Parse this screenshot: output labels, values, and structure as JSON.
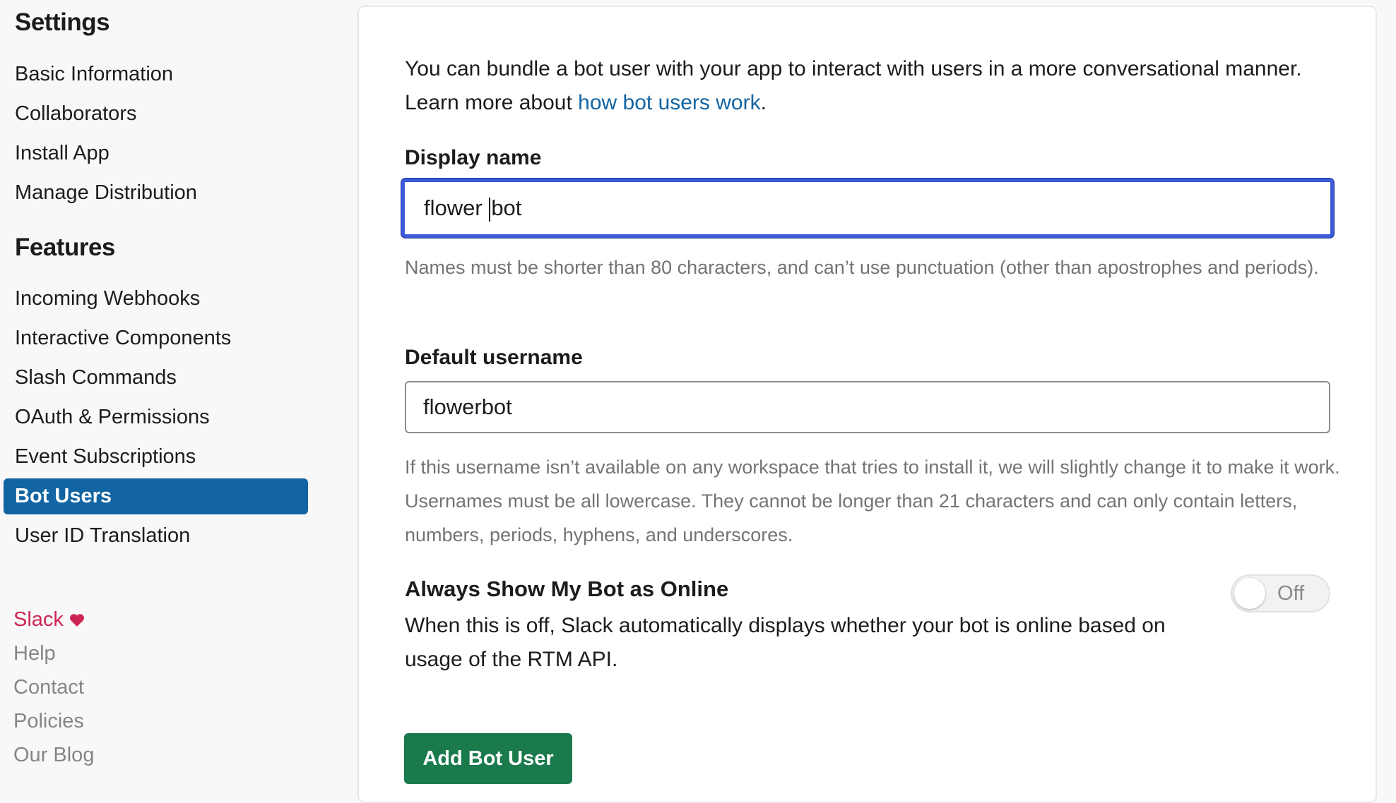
{
  "sidebar": {
    "settings_heading": "Settings",
    "settings_items": [
      {
        "label": "Basic Information"
      },
      {
        "label": "Collaborators"
      },
      {
        "label": "Install App"
      },
      {
        "label": "Manage Distribution"
      }
    ],
    "features_heading": "Features",
    "features_items": [
      {
        "label": "Incoming Webhooks"
      },
      {
        "label": "Interactive Components"
      },
      {
        "label": "Slash Commands"
      },
      {
        "label": "OAuth & Permissions"
      },
      {
        "label": "Event Subscriptions"
      },
      {
        "label": "Bot Users",
        "active": true
      },
      {
        "label": "User ID Translation"
      }
    ],
    "footer": {
      "brand": "Slack",
      "links": [
        "Help",
        "Contact",
        "Policies",
        "Our Blog"
      ]
    }
  },
  "main": {
    "intro_text": "You can bundle a bot user with your app to interact with users in a more conversational manner. Learn more about ",
    "intro_link": "how bot users work",
    "intro_end": ".",
    "display_name": {
      "label": "Display name",
      "value_before_caret": "flower ",
      "value_after_caret": "bot",
      "hint": "Names must be shorter than 80 characters, and can’t use punctuation (other than apostrophes and periods)."
    },
    "default_username": {
      "label": "Default username",
      "value": "flowerbot",
      "hint": "If this username isn’t available on any workspace that tries to install it, we will slightly change it to make it work. Usernames must be all lowercase. They cannot be longer than 21 characters and can only contain letters, numbers, periods, hyphens, and underscores."
    },
    "online_toggle": {
      "title": "Always Show My Bot as Online",
      "description": "When this is off, Slack automatically displays whether your bot is online based on usage of the RTM API.",
      "state_label": "Off"
    },
    "add_button": "Add Bot User"
  },
  "colors": {
    "active_nav": "#1264a3",
    "link": "#1264a3",
    "focus_border": "#3d5bd6",
    "primary_button": "#1a7a4c",
    "brand": "#cd2553"
  }
}
